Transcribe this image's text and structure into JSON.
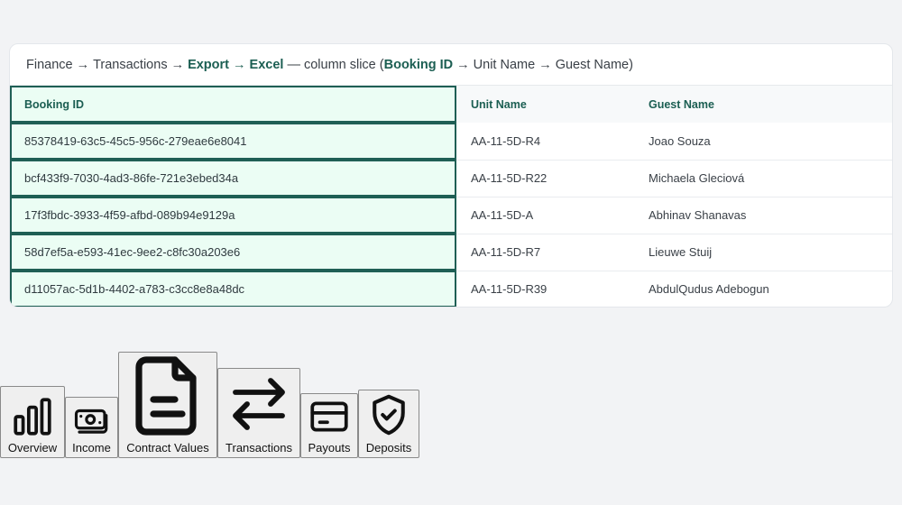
{
  "breadcrumb": {
    "finance": "Finance",
    "arrow": "→",
    "transactions": "Transactions",
    "export": "Export → Excel",
    "slice_prefix": "— column slice (",
    "slice_key": "Booking ID",
    "slice_rest": "→ Unit Name → Guest Name)"
  },
  "table": {
    "columns": [
      "Booking ID",
      "Unit Name",
      "Guest Name"
    ],
    "rows": [
      [
        "85378419-63c5-45c5-956c-279eae6e8041",
        "AA-11-5D-R4",
        "Joao Souza"
      ],
      [
        "bcf433f9-7030-4ad3-86fe-721e3ebed34a",
        "AA-11-5D-R22",
        "Michaela Gleciová"
      ],
      [
        "17f3fbdc-3933-4f59-afbd-089b94e9129a",
        "AA-11-5D-A",
        "Abhinav Shanavas"
      ],
      [
        "58d7ef5a-e593-41ec-9ee2-c8fc30a203e6",
        "AA-11-5D-R7",
        "Lieuwe Stuij"
      ],
      [
        "d11057ac-5d1b-4402-a783-c3cc8e8a48dc",
        "AA-11-5D-R39",
        "AbdulQudus Adebogun"
      ]
    ]
  },
  "toolbar": {
    "overview": {
      "label": "Overview",
      "icon": "bar-chart-icon"
    },
    "income": {
      "label": "Income",
      "icon": "banknote-icon"
    },
    "contract_values": {
      "label": "Contract Values",
      "icon": "document-icon"
    },
    "transactions": {
      "label": "Transactions",
      "icon": "arrows-exchange-icon"
    },
    "payouts": {
      "label": "Payouts",
      "icon": "credit-card-icon"
    },
    "deposits": {
      "label": "Deposits",
      "icon": "shield-check-icon"
    }
  },
  "colors": {
    "accent": "#1b5e52",
    "highlight_bg": "#ebfdf4",
    "highlight_border": "#1f5f55"
  }
}
